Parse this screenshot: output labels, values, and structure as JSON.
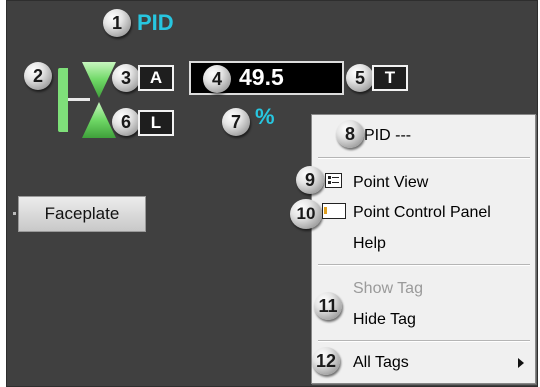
{
  "controller": {
    "tag": "PID",
    "mode_buttons": {
      "auto": "A",
      "local": "L",
      "trend": "T"
    },
    "pv_value": "49.5",
    "units": "%"
  },
  "faceplate_button": "Faceplate",
  "context_menu": {
    "header": "PID ---",
    "items": [
      {
        "label": "Point View",
        "icon": "point-view-icon"
      },
      {
        "label": "Point Control Panel",
        "icon": "control-panel-icon"
      },
      {
        "label": "Help"
      },
      {
        "label": "Show Tag",
        "state": "disabled"
      },
      {
        "label": "Hide Tag"
      },
      {
        "label": "All Tags",
        "submenu": true
      }
    ]
  },
  "callouts": [
    "1",
    "2",
    "3",
    "4",
    "5",
    "6",
    "7",
    "8",
    "9",
    "10",
    "11",
    "12"
  ],
  "colors": {
    "background": "#404040",
    "accent": "#27c6e0",
    "valve_green": "#7fe07a"
  }
}
